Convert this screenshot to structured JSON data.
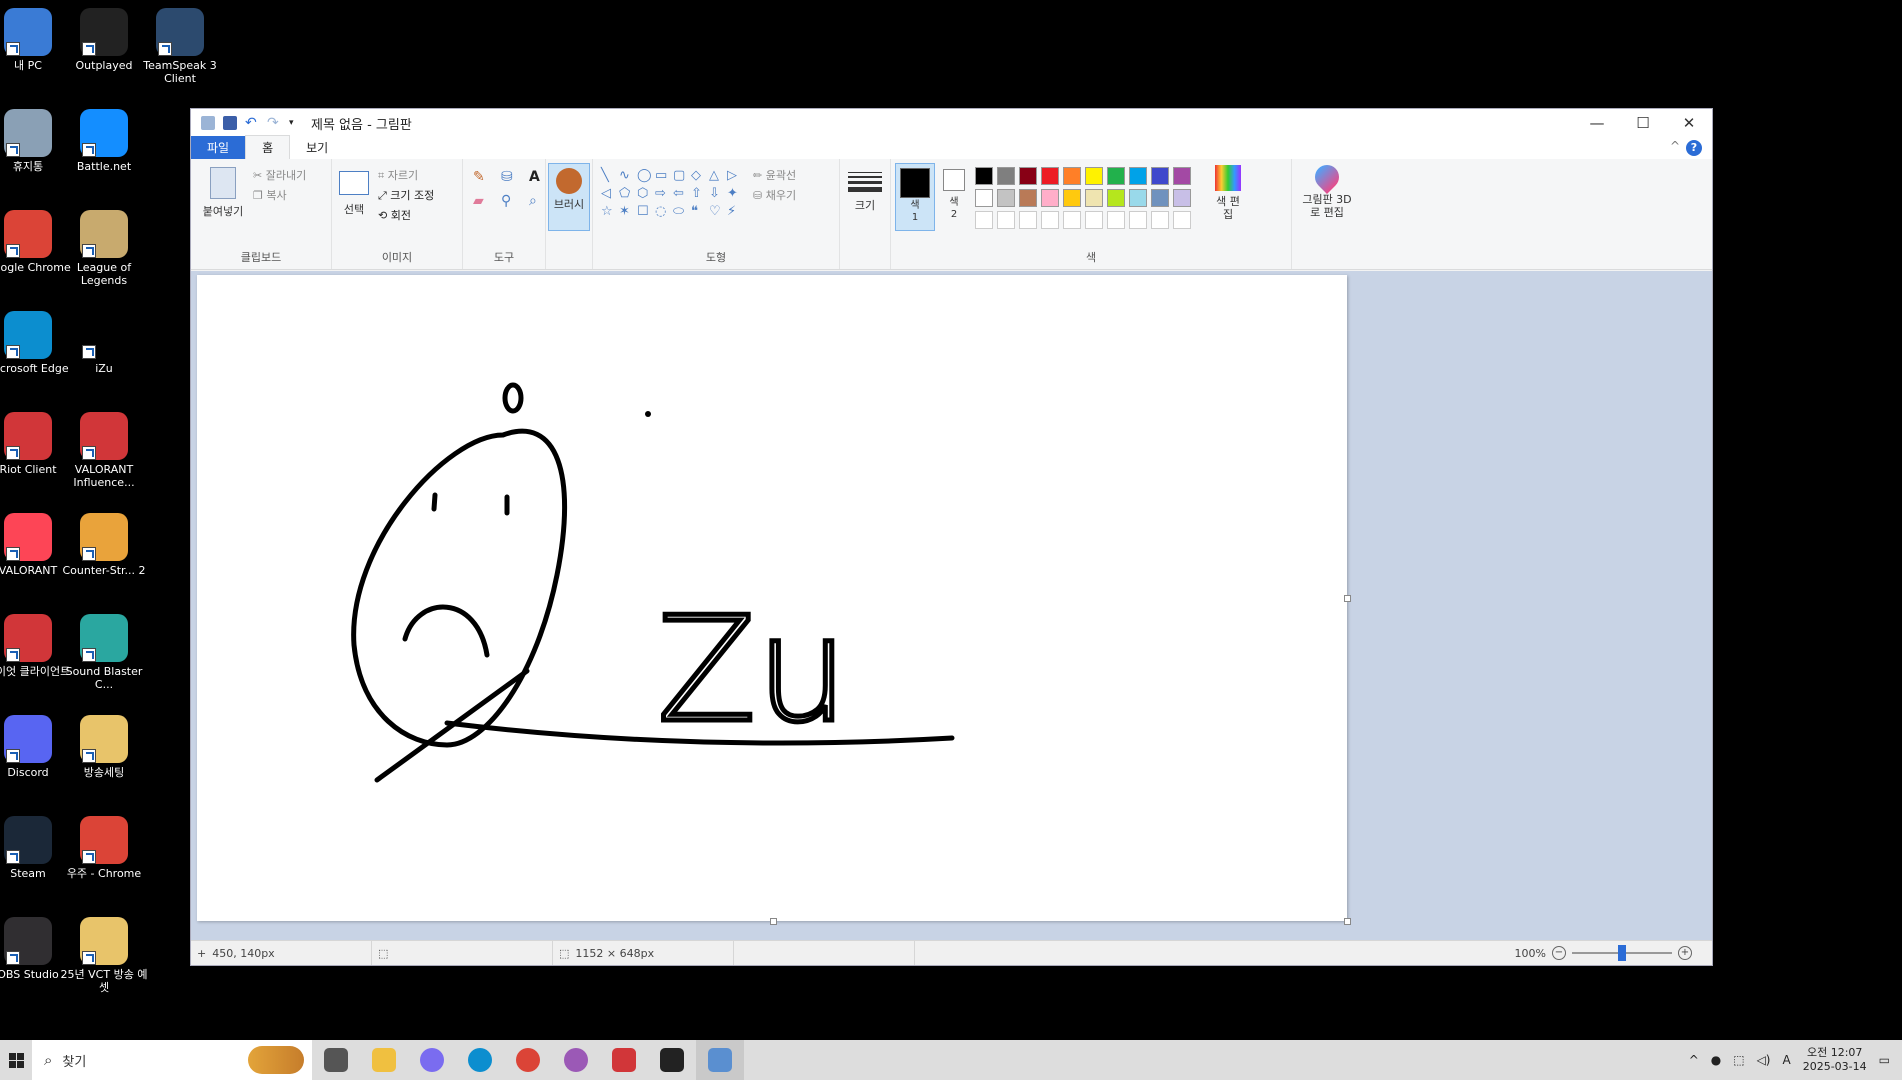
{
  "desktop": {
    "icons": [
      {
        "label": "내 PC",
        "icon": "this-pc-icon",
        "color": "#3a7bd5"
      },
      {
        "label": "Outplayed",
        "icon": "outplayed-icon",
        "color": "#222222"
      },
      {
        "label": "TeamSpeak 3 Client",
        "icon": "teamspeak-icon",
        "color": "#2c4a6e"
      },
      {
        "label": "휴지통",
        "icon": "recycle-bin-icon",
        "color": "#8aa0b5"
      },
      {
        "label": "Battle.net",
        "icon": "battlenet-icon",
        "color": "#148eff"
      },
      {
        "label": "Google Chrome",
        "icon": "chrome-icon",
        "color": "#db4437"
      },
      {
        "label": "League of Legends",
        "icon": "league-icon",
        "color": "#c8aa6e"
      },
      {
        "label": "Microsoft Edge",
        "icon": "edge-icon",
        "color": "#0c8ecf"
      },
      {
        "label": "iZu",
        "icon": "izu-icon",
        "color": "#000000"
      },
      {
        "label": "Riot Client",
        "icon": "riot-client-icon",
        "color": "#d13639"
      },
      {
        "label": "VALORANT Influence...",
        "icon": "riot-client-icon",
        "color": "#d13639"
      },
      {
        "label": "VALORANT",
        "icon": "valorant-icon",
        "color": "#fd4556"
      },
      {
        "label": "Counter-Str... 2",
        "icon": "counter-strike-icon",
        "color": "#e9a33b"
      },
      {
        "label": "라이엇 클라이언트",
        "icon": "riot-client-icon",
        "color": "#d13639"
      },
      {
        "label": "Sound Blaster C...",
        "icon": "sound-blaster-icon",
        "color": "#2aa7a0"
      },
      {
        "label": "Discord",
        "icon": "discord-icon",
        "color": "#5865f2"
      },
      {
        "label": "방송세팅",
        "icon": "folder-icon",
        "color": "#e8c46a"
      },
      {
        "label": "Steam",
        "icon": "steam-icon",
        "color": "#1b2838"
      },
      {
        "label": "우주 - Chrome",
        "icon": "chrome-profile-icon",
        "color": "#db4437"
      },
      {
        "label": "OBS Studio",
        "icon": "obs-icon",
        "color": "#302e31"
      },
      {
        "label": "25년 VCT 방송 예셋",
        "icon": "document-icon",
        "color": "#e8c46a"
      }
    ]
  },
  "window": {
    "title": "제목 없음 - 그림판",
    "controls": {
      "minimize": "—",
      "maximize": "☐",
      "close": "✕"
    },
    "tabs": [
      "파일",
      "홈",
      "보기"
    ],
    "help": "?",
    "collapse": "^"
  },
  "ribbon": {
    "clipboard": {
      "paste": "붙여넣기",
      "cut": "잘라내기",
      "copy": "복사",
      "name": "클립보드"
    },
    "image": {
      "select": "선택",
      "crop": "자르기",
      "resize": "크기 조정",
      "rotate": "회전",
      "name": "이미지"
    },
    "tools": {
      "name": "도구"
    },
    "brush": {
      "label": "브러시"
    },
    "shapes": {
      "outline": "윤곽선",
      "fill": "채우기",
      "name": "도형"
    },
    "size": {
      "label": "크기"
    },
    "colors": {
      "color1": "색 1",
      "color2": "색 2",
      "edit": "색 편집",
      "name": "색",
      "palette_row1": [
        "#000000",
        "#7f7f7f",
        "#880015",
        "#ed1c24",
        "#ff7f27",
        "#fff200",
        "#22b14c",
        "#00a2e8",
        "#3f48cc",
        "#a349a4"
      ],
      "palette_row2": [
        "#ffffff",
        "#c3c3c3",
        "#b97a57",
        "#ffaec9",
        "#ffc90e",
        "#efe4b0",
        "#b5e61d",
        "#99d9ea",
        "#7092be",
        "#c8bfe7"
      ]
    },
    "paint3d": {
      "label": "그림판 3D로 편집"
    }
  },
  "canvas": {
    "drawing_text": "Zu"
  },
  "status": {
    "cursor_pos": "450, 140px",
    "selection_size": "",
    "canvas_size": "1152 × 648px",
    "zoom": "100%",
    "zoom_level": 0.5
  },
  "taskbar": {
    "search_placeholder": "찾기",
    "tray_ime": "A",
    "time": "오전 12:07",
    "date": "2025-03-14",
    "apps": [
      "task-view-icon",
      "file-explorer-icon",
      "copilot-icon",
      "edge-icon",
      "chrome-icon",
      "chrome-profile-icon",
      "riot-client-icon",
      "outplayed-icon",
      "paint-icon"
    ]
  }
}
